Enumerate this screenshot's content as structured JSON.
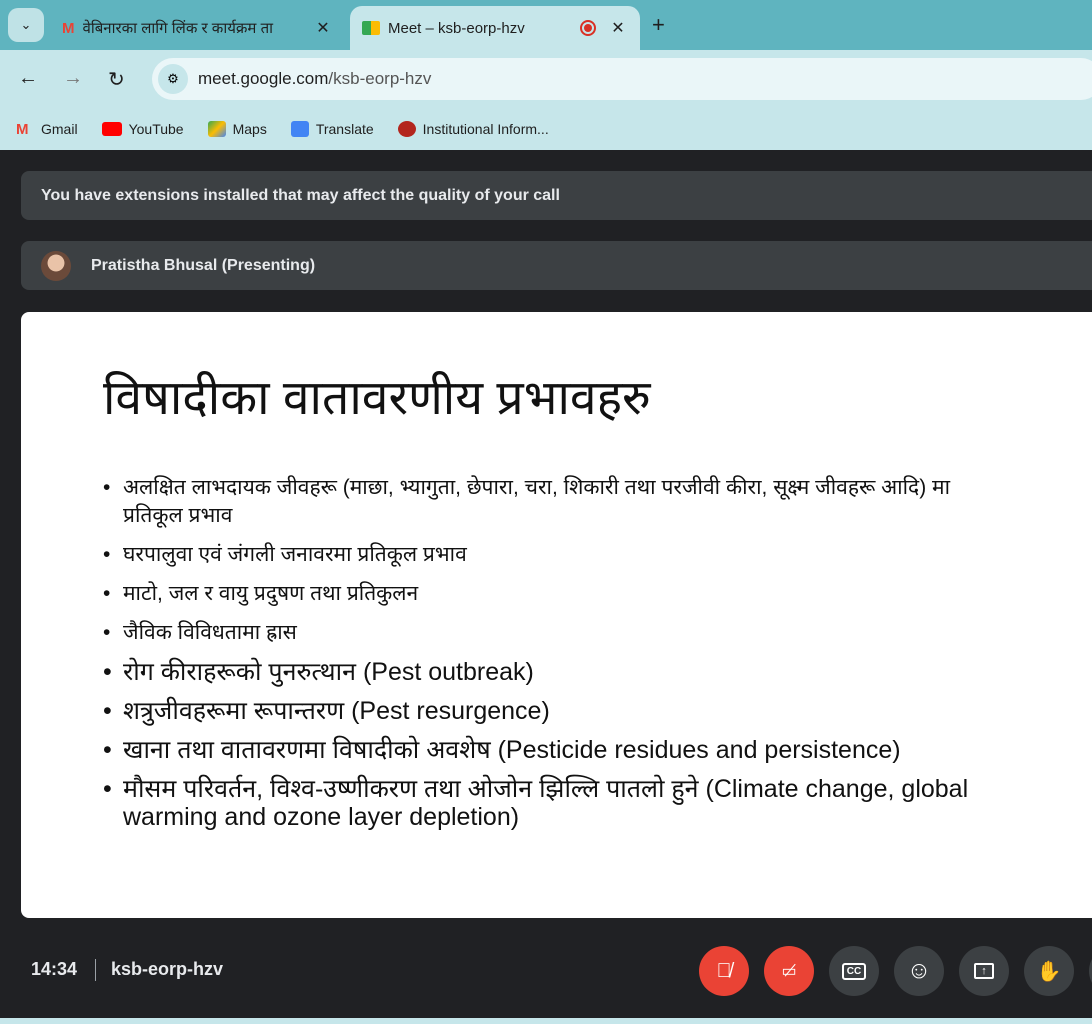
{
  "browser": {
    "tabs": [
      {
        "title": "वेबिनारका लागि लिंक र कार्यक्रम ता",
        "icon": "gmail-icon",
        "active": false
      },
      {
        "title": "Meet – ksb-eorp-hzv",
        "icon": "meet-icon",
        "active": true,
        "recording": true
      }
    ],
    "url_host": "meet.google.com",
    "url_path": "/ksb-eorp-hzv",
    "bookmarks": [
      {
        "label": "Gmail",
        "icon": "gmail-icon",
        "color": "#ea4335"
      },
      {
        "label": "YouTube",
        "icon": "youtube-icon",
        "color": "#ff0000"
      },
      {
        "label": "Maps",
        "icon": "maps-icon",
        "color": "#34a853"
      },
      {
        "label": "Translate",
        "icon": "translate-icon",
        "color": "#4285f4"
      },
      {
        "label": "Institutional Inform...",
        "icon": "emblem-icon",
        "color": "#b3261e"
      }
    ]
  },
  "meet": {
    "extension_banner": "You have extensions installed that may affect the quality of your call",
    "presenter": "Pratistha Bhusal (Presenting)",
    "slide": {
      "title": "विषादीका वातावरणीय प्रभावहरु",
      "bullets": [
        "अलक्षित लाभदायक जीवहरू (माछा, भ्यागुता, छेपारा, चरा, शिकारी तथा परजीवी कीरा, सूक्ष्म जीवहरू आदि) मा प्रतिकूल प्रभाव",
        "घरपालुवा एवं जंगली जनावरमा प्रतिकूल प्रभाव",
        " माटो, जल र वायु प्रदुषण तथा प्रतिकुलन",
        " जैविक विविधतामा ह्रास",
        "रोग कीराहरूको पुनरुत्थान (Pest outbreak)",
        "शत्रुजीवहरूमा रूपान्तरण (Pest resurgence)",
        " खाना तथा वातावरणमा विषादीको अवशेष (Pesticide residues and persistence)",
        "मौसम परिवर्तन, विश्व-उष्णीकरण तथा ओजोन झिल्लि पातलो हुने (Climate change, global warming and ozone layer depletion)"
      ]
    },
    "time": "14:34",
    "meeting_code": "ksb-eorp-hzv",
    "controls": {
      "mic": "muted",
      "camera": "off",
      "accent_red": "#ea4335"
    }
  }
}
